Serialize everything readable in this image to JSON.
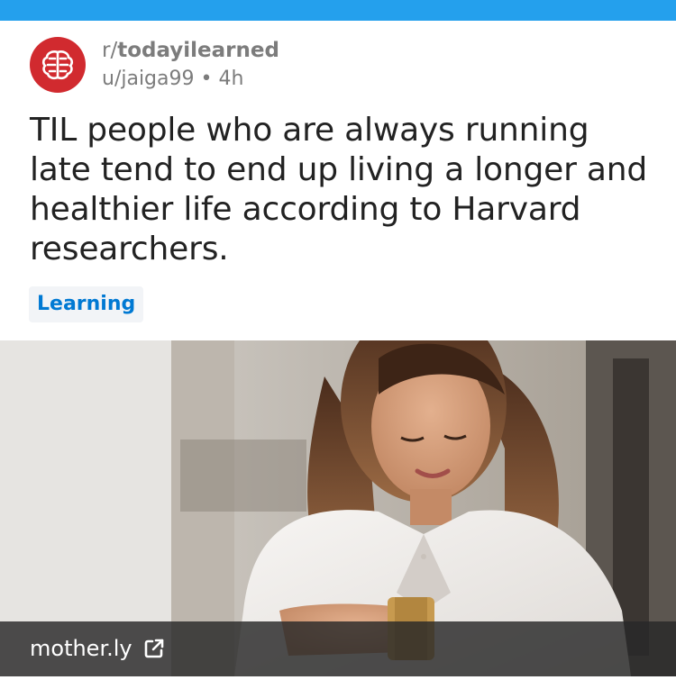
{
  "post": {
    "subreddit_prefix": "r/",
    "subreddit": "todayilearned",
    "author_meta": "u/jaiga99 • 4h",
    "title": "TIL people who are always running late tend to end up living a longer and healthier life according to Harvard researchers.",
    "flair": "Learning",
    "link_domain": "mother.ly"
  },
  "colors": {
    "top_bar": "#24a0ed",
    "avatar_bg": "#d12a2f",
    "flair_text": "#0079d3",
    "flair_bg": "#f2f4f7"
  },
  "icons": {
    "avatar": "brain-icon",
    "external_link": "external-link-icon"
  }
}
